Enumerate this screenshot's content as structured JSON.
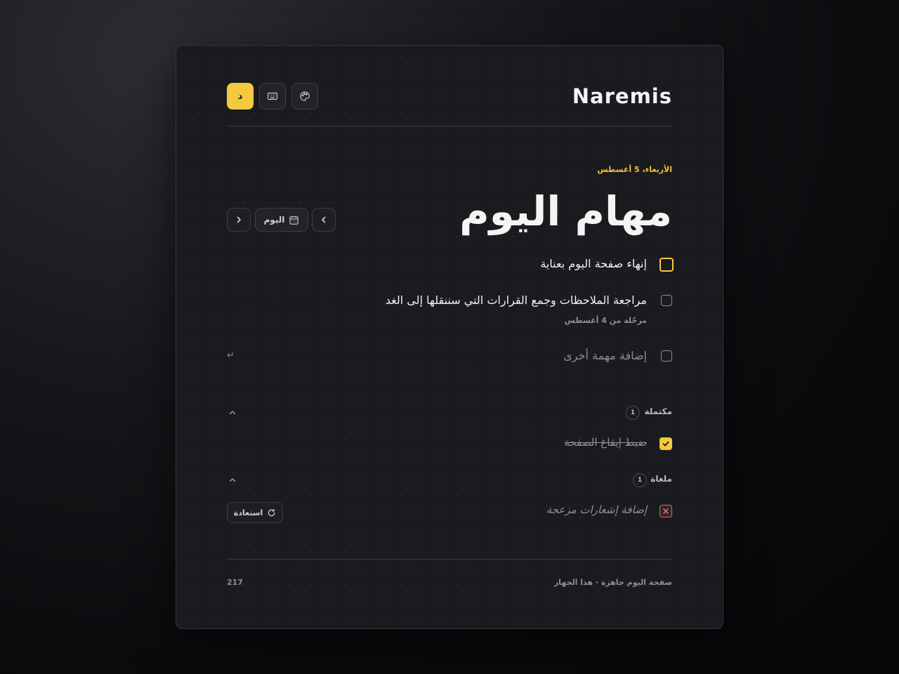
{
  "header": {
    "brand": "Naremis",
    "lang_button": "د",
    "keyboard_icon": "keyboard-icon",
    "palette_icon": "palette-icon"
  },
  "day": {
    "date": "الأربعاء، 5 أغسطس",
    "title": "مهام اليوم",
    "today_label": "اليوم"
  },
  "tasks": [
    {
      "text": "إنهاء صفحة اليوم بعناية",
      "state": "focused"
    },
    {
      "text": "مراجعة الملاحظات وجمع القرارات التي سننقلها إلى الغد",
      "sub": "مرحّلة من 4 أغسطس",
      "state": "open"
    }
  ],
  "new_task": {
    "placeholder": "إضافة مهمة أخرى",
    "enter_hint": "↵"
  },
  "completed": {
    "label": "مكتملة",
    "count": "1",
    "items": [
      {
        "text": "ضبط إيقاع الصفحة"
      }
    ]
  },
  "cancelled": {
    "label": "ملغاة",
    "count": "1",
    "items": [
      {
        "text": "إضافة إشعارات مزعجة"
      }
    ],
    "restore_label": "استعادة"
  },
  "footer": {
    "status": "صفحة اليوم جاهزة · هذا الجهاز",
    "counter": "217"
  },
  "colors": {
    "accent": "#f5c93d",
    "cancel": "#d36b6b",
    "background": "#1a1b1e"
  }
}
